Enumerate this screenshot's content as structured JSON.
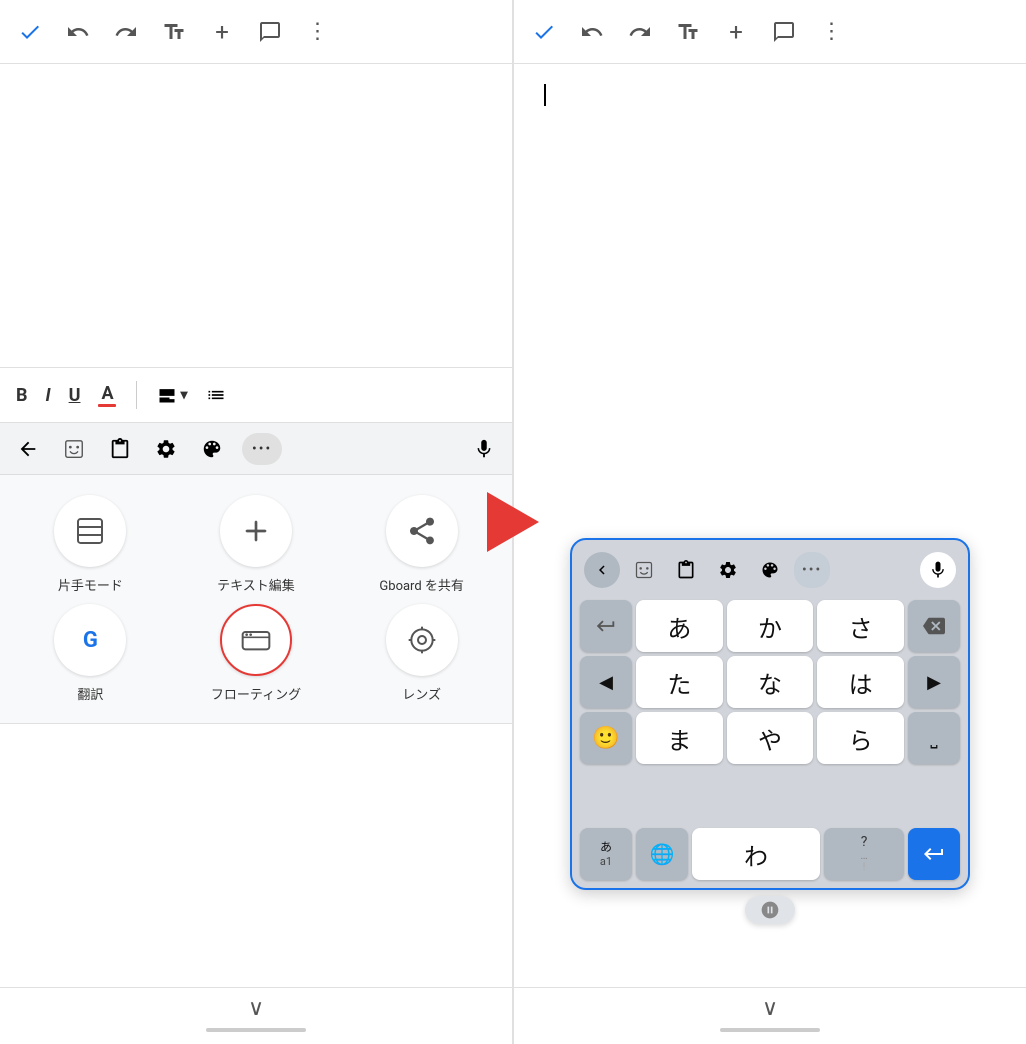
{
  "left_panel": {
    "toolbar": {
      "check_label": "✓",
      "undo_label": "↩",
      "redo_label": "↪",
      "text_format_label": "Ā",
      "add_label": "+",
      "comment_label": "☰",
      "more_label": "⋮"
    },
    "format_bar": {
      "bold": "B",
      "italic": "I",
      "underline": "U",
      "underline_color": "A",
      "align": "≡",
      "list": "≡"
    },
    "kb_toolbar": {
      "back_label": "←",
      "emoji_label": "😊",
      "clipboard_label": "📋",
      "settings_label": "⚙",
      "theme_label": "🎨",
      "more_label": "...",
      "mic_label": "🎤"
    },
    "menu_items": [
      {
        "id": "one-hand",
        "icon": "⬛",
        "label": "片手モード"
      },
      {
        "id": "text-edit",
        "icon": "↕",
        "label": "テキスト編集"
      },
      {
        "id": "share-gboard",
        "icon": "⤴",
        "label": "Gboard を共有"
      },
      {
        "id": "translate",
        "icon": "G",
        "label": "翻訳",
        "special": "translate"
      },
      {
        "id": "floating",
        "icon": "⌨",
        "label": "フローティング",
        "selected": true
      },
      {
        "id": "lens",
        "icon": "◎",
        "label": "レンズ"
      }
    ],
    "bottom": {
      "chevron": "∨"
    }
  },
  "right_panel": {
    "toolbar": {
      "check_label": "✓",
      "undo_label": "↩",
      "redo_label": "↪",
      "text_format_label": "Ā",
      "add_label": "+",
      "comment_label": "☰",
      "more_label": "⋮"
    },
    "doc": {
      "cursor": "|"
    },
    "floating_keyboard": {
      "top_icons": {
        "back": "‹",
        "emoji_board": "🙂",
        "clipboard": "📋",
        "settings": "⚙",
        "theme": "🎨",
        "more": "...",
        "mic": "🎤"
      },
      "keys_row1": [
        "↩",
        "あ",
        "か",
        "さ",
        "⌫"
      ],
      "keys_row2": [
        "◀",
        "た",
        "な",
        "は",
        "▶"
      ],
      "keys_row3": [
        "😊",
        "ま",
        "や",
        "ら",
        "⏎"
      ],
      "keys_row4_left": "あa1",
      "keys_row4_globe": "🌐",
      "keys_row4_wa": "わ",
      "keys_row4_special_top": "?",
      "keys_row4_special_bottom": "…",
      "keys_row4_return": "↵",
      "drag_icon": "⊕"
    },
    "bottom": {
      "chevron": "∨"
    }
  },
  "arrow": {
    "color": "#e53935"
  },
  "colors": {
    "blue": "#1a73e8",
    "red": "#e53935",
    "toolbar_bg": "#f1f3f4",
    "key_bg": "#fff",
    "side_key_bg": "#b0b8c1",
    "kb_border": "#1a73e8"
  }
}
